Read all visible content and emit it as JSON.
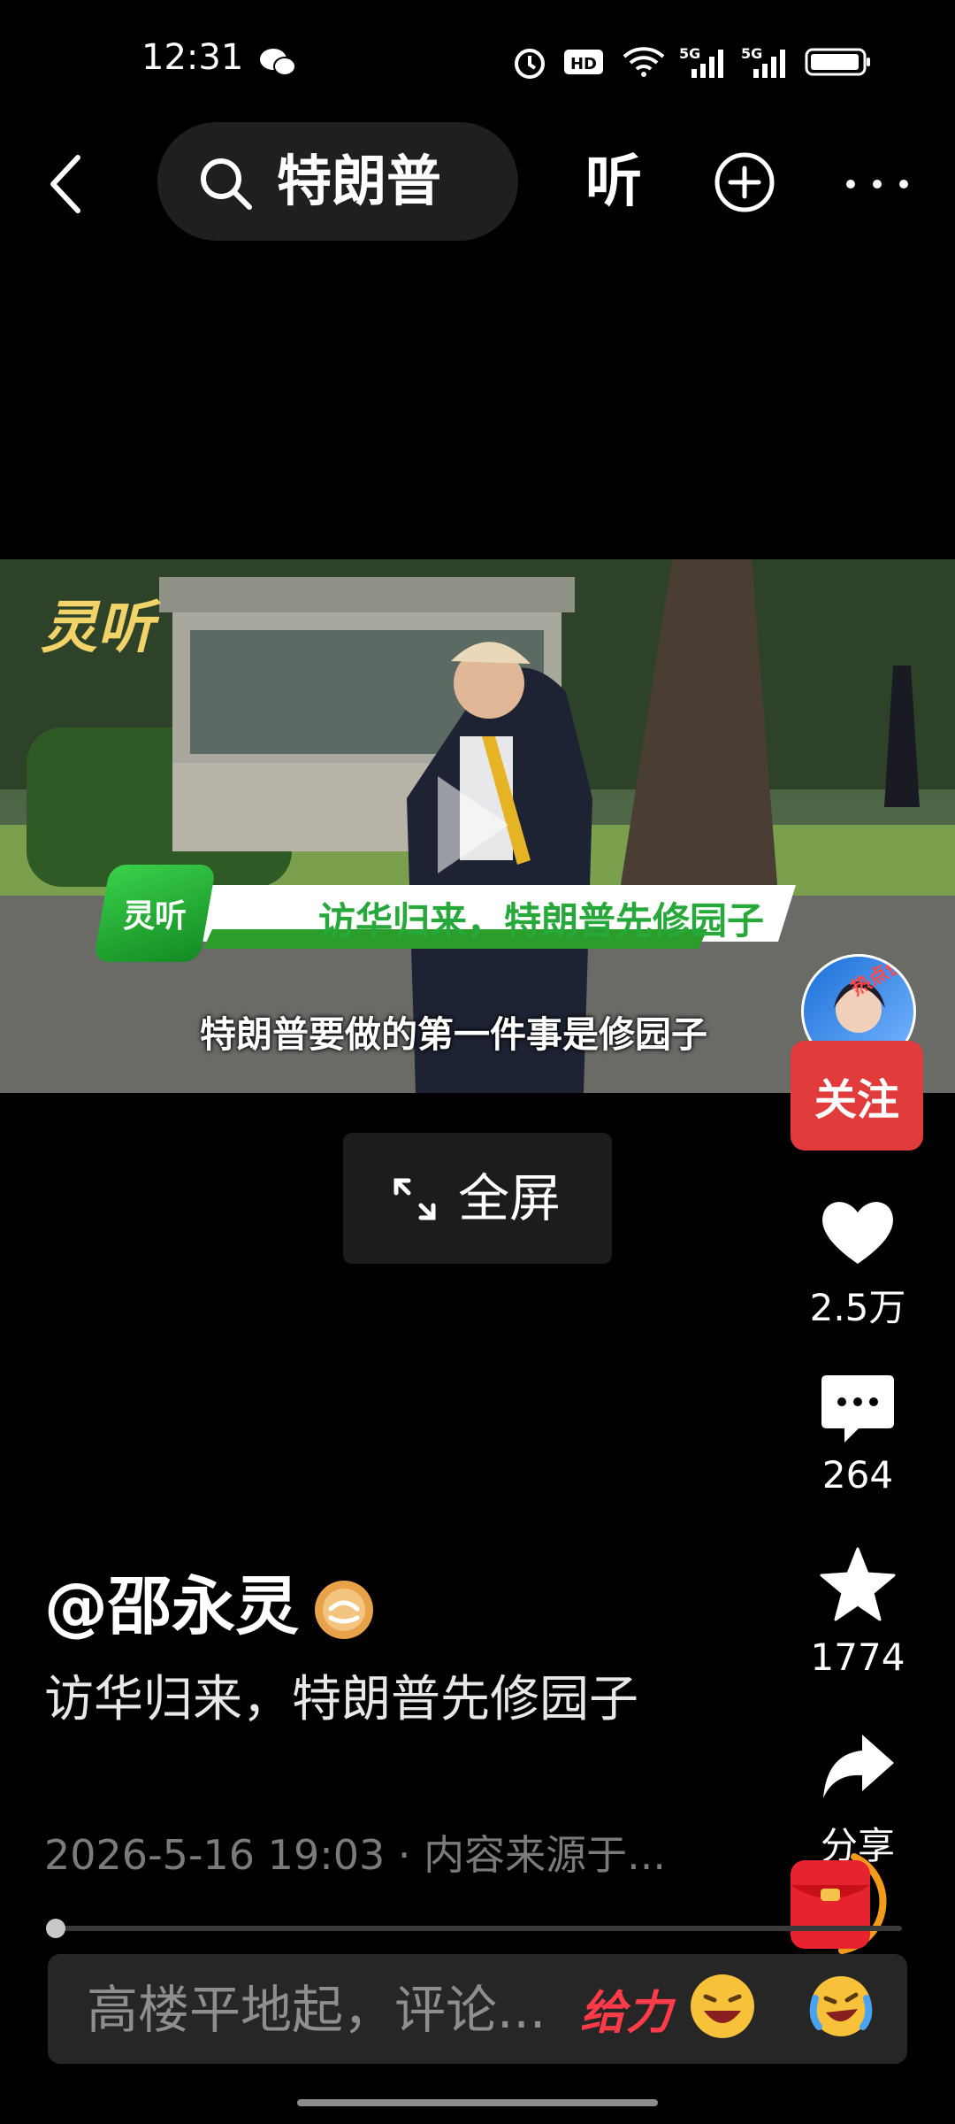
{
  "status_bar": {
    "time": "12:31",
    "icons": [
      "wechat-icon",
      "alarm-icon",
      "hd-icon",
      "wifi-icon",
      "signal-5g-icon",
      "signal-5g-icon",
      "battery-icon"
    ]
  },
  "top_bar": {
    "search_query": "特朗普",
    "listen_label": "听"
  },
  "video": {
    "watermark": "灵听",
    "overlay_badge": "灵听",
    "overlay_title": "访华归来，特朗普先修园子",
    "caption": "特朗普要做的第一件事是修园子",
    "avatar_tag": "热点侠"
  },
  "fullscreen_label": "全屏",
  "actions": {
    "follow": "关注",
    "likes": "2.5万",
    "comments": "264",
    "favorites": "1774",
    "share": "分享"
  },
  "post": {
    "author": "@邵永灵",
    "description": "访华归来，特朗普先修园子",
    "meta": "2026-5-16 19:03 · 内容来源于...",
    "progress": 0.01
  },
  "comment_bar": {
    "placeholder": "高楼平地起，评论...",
    "sticker": "给力"
  },
  "colors": {
    "background": "#000000",
    "follow_button": "#e23b3b",
    "overlay_green": "#27a83a",
    "verified_badge": "#e8a24a"
  }
}
